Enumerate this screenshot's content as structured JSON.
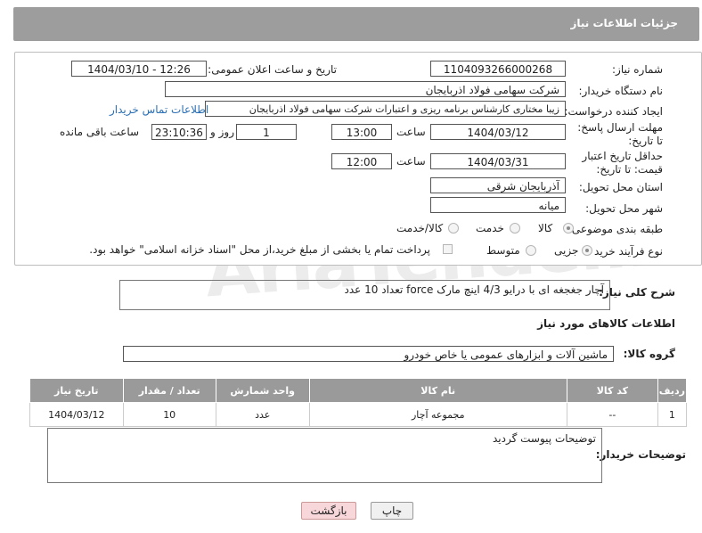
{
  "header": {
    "title": "جزئیات اطلاعات نیاز"
  },
  "form": {
    "need_number_label": "شماره نیاز:",
    "need_number": "1104093266000268",
    "announce_label": "تاریخ و ساعت اعلان عمومی:",
    "announce_value": "1404/03/10 - 12:26",
    "buyer_org_label": "نام دستگاه خریدار:",
    "buyer_org": "شرکت سهامی فولاد اذربایجان",
    "creator_label": "ایجاد کننده درخواست:",
    "creator": "زیبا مختاری کارشناس برنامه ریزی و اعتبارات شرکت سهامی فولاد اذربایجان",
    "contact_link": "اطلاعات تماس خریدار",
    "reply_deadline_label": "مهلت ارسال پاسخ: تا تاریخ:",
    "reply_date": "1404/03/12",
    "time_label": "ساعت",
    "reply_time": "13:00",
    "days_value": "1",
    "days_label": "روز و",
    "remaining_time": "23:10:36",
    "remaining_label": "ساعت باقی مانده",
    "price_validity_label": "حداقل تاریخ اعتبار قیمت: تا تاریخ:",
    "price_date": "1404/03/31",
    "price_time": "12:00",
    "province_label": "استان محل تحویل:",
    "province": "آذربایجان شرقی",
    "city_label": "شهر محل تحویل:",
    "city": "میانه",
    "category_label": "طبقه بندی موضوعی:",
    "category_options": [
      "کالا",
      "خدمت",
      "کالا/خدمت"
    ],
    "process_label": "نوع فرآیند خرید :",
    "process_options": [
      "جزیی",
      "متوسط"
    ],
    "payment_note": "پرداخت تمام یا بخشی از مبلغ خرید،از محل \"اسناد خزانه اسلامی\" خواهد بود."
  },
  "description": {
    "label": "شرح کلی نیاز:",
    "text": "آچار جغجغه ای با درایو 4/3 اینچ مارک force تعداد 10 عدد"
  },
  "goods_info_title": "اطلاعات کالاهای مورد نیاز",
  "goods_group": {
    "label": "گروه کالا:",
    "value": "ماشین آلات و ابزارهای عمومی یا خاص خودرو"
  },
  "table": {
    "headers": [
      "ردیف",
      "کد کالا",
      "نام کالا",
      "واحد شمارش",
      "تعداد / مقدار",
      "تاریخ نیاز"
    ],
    "rows": [
      [
        "1",
        "--",
        "مجموعه آچار",
        "عدد",
        "10",
        "1404/03/12"
      ]
    ]
  },
  "buyer_notes": {
    "label": "توضیحات خریدار:",
    "text": "توضیحات پیوست گردید"
  },
  "buttons": {
    "print": "چاپ",
    "back": "بازگشت"
  },
  "watermark": "AriaTender.net",
  "colors": {
    "header_bg": "#9d9d9d",
    "link": "#2a6fb5",
    "back_button_bg": "#f7d7da"
  }
}
